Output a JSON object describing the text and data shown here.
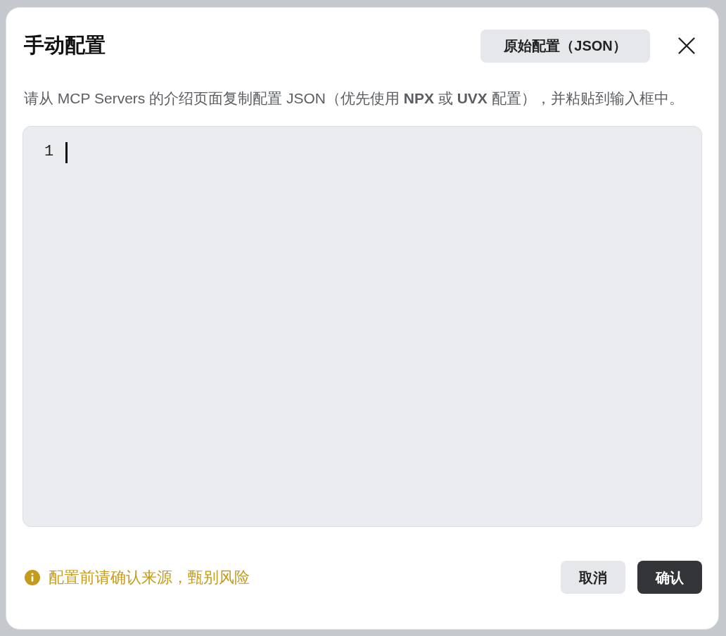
{
  "dialog": {
    "title": "手动配置",
    "mode_button": "原始配置（JSON）",
    "description": "请从 MCP Servers 的介绍页面复制配置 JSON（优先使用 **NPX** 或 **UVX** 配置），并粘贴到输入框中。"
  },
  "editor": {
    "line_numbers": [
      "1"
    ],
    "focused": true
  },
  "footer": {
    "warning": "配置前请确认来源，甄别风险",
    "buttons": [
      {
        "label": "取消",
        "kind": "secondary"
      },
      {
        "label": "确认",
        "kind": "primary"
      }
    ]
  }
}
